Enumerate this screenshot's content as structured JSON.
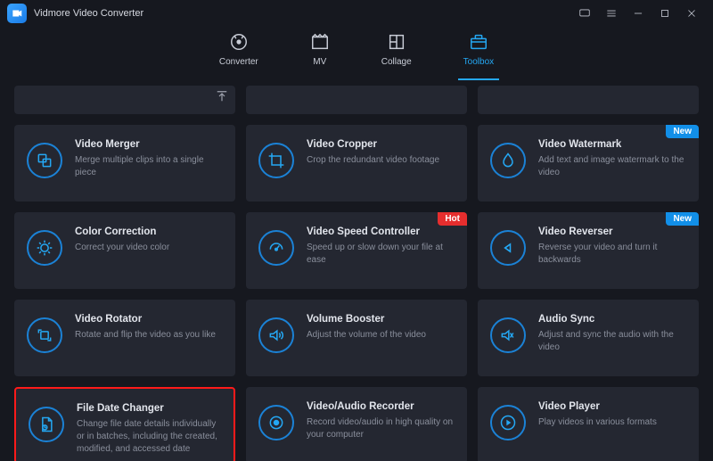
{
  "title": "Vidmore Video Converter",
  "accent": "#24a8f4",
  "tabs": [
    {
      "label": "Converter"
    },
    {
      "label": "MV"
    },
    {
      "label": "Collage"
    },
    {
      "label": "Toolbox"
    }
  ],
  "activeTab": 3,
  "badges": {
    "new": "New",
    "hot": "Hot"
  },
  "cards": [
    {
      "title": "Video Merger",
      "desc": "Merge multiple clips into a single piece"
    },
    {
      "title": "Video Cropper",
      "desc": "Crop the redundant video footage"
    },
    {
      "title": "Video Watermark",
      "desc": "Add text and image watermark to the video",
      "badge": "new"
    },
    {
      "title": "Color Correction",
      "desc": "Correct your video color"
    },
    {
      "title": "Video Speed Controller",
      "desc": "Speed up or slow down your file at ease",
      "badge": "hot"
    },
    {
      "title": "Video Reverser",
      "desc": "Reverse your video and turn it backwards",
      "badge": "new"
    },
    {
      "title": "Video Rotator",
      "desc": "Rotate and flip the video as you like"
    },
    {
      "title": "Volume Booster",
      "desc": "Adjust the volume of the video"
    },
    {
      "title": "Audio Sync",
      "desc": "Adjust and sync the audio with the video"
    },
    {
      "title": "File Date Changer",
      "desc": "Change file date details individually or in batches, including the created, modified, and accessed date",
      "highlight": true
    },
    {
      "title": "Video/Audio Recorder",
      "desc": "Record video/audio in high quality on your computer"
    },
    {
      "title": "Video Player",
      "desc": "Play videos in various formats"
    }
  ]
}
